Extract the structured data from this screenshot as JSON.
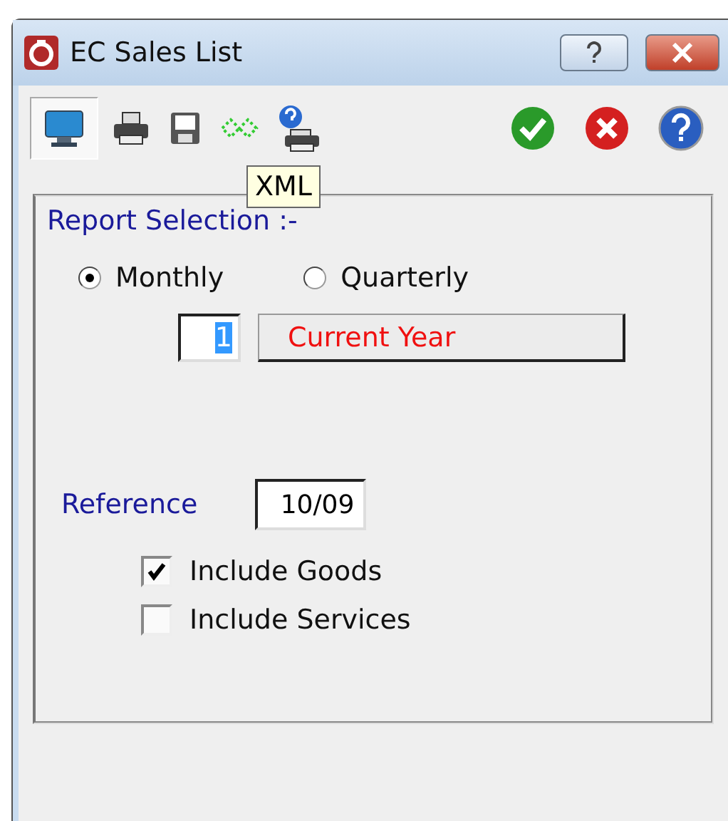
{
  "window": {
    "title": "EC Sales List"
  },
  "toolbar": {
    "left": [
      {
        "kind": "monitor",
        "pressed": true
      },
      {
        "kind": "printer",
        "pressed": false
      },
      {
        "kind": "floppy",
        "pressed": false
      },
      {
        "kind": "xml",
        "pressed": false
      },
      {
        "kind": "help-printer",
        "pressed": false
      }
    ],
    "right": [
      {
        "kind": "ok"
      },
      {
        "kind": "cancel"
      },
      {
        "kind": "help"
      }
    ]
  },
  "tooltip": {
    "text": "XML"
  },
  "report_selection": {
    "label": "Report Selection :-",
    "options": [
      {
        "label": "Monthly",
        "selected": true
      },
      {
        "label": "Quarterly",
        "selected": false
      }
    ],
    "period": {
      "value": "1"
    },
    "year_button": "Current Year"
  },
  "reference": {
    "label": "Reference",
    "value": "10/09"
  },
  "checkboxes": [
    {
      "label": "Include Goods",
      "checked": true
    },
    {
      "label": "Include Services",
      "checked": false
    }
  ]
}
